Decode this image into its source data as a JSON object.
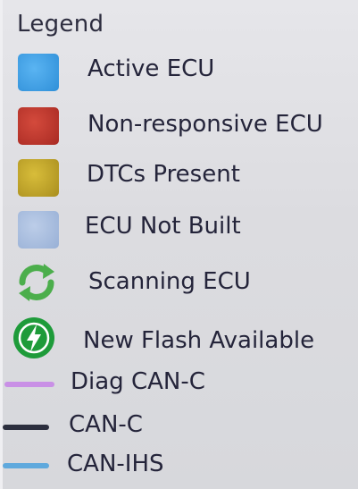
{
  "legend": {
    "title": "Legend",
    "items": [
      {
        "label": "Active ECU",
        "icon": "blue-square-icon",
        "color": "#3e9fe6"
      },
      {
        "label": "Non-responsive ECU",
        "icon": "red-square-icon",
        "color": "#c0332b"
      },
      {
        "label": "DTCs Present",
        "icon": "yellow-square-icon",
        "color": "#c9ad2a"
      },
      {
        "label": "ECU Not Built",
        "icon": "light-blue-square-icon",
        "color": "#a9bfdf"
      },
      {
        "label": "Scanning ECU",
        "icon": "refresh-arrows-icon",
        "color": "#4cae4c"
      },
      {
        "label": "New Flash Available",
        "icon": "lightning-circle-icon",
        "color": "#1e9b3a"
      },
      {
        "label": "Diag CAN-C",
        "icon": "violet-line-icon",
        "color": "#c990e6"
      },
      {
        "label": "CAN-C",
        "icon": "dark-line-icon",
        "color": "#2c2f3e"
      },
      {
        "label": "CAN-IHS",
        "icon": "sky-line-icon",
        "color": "#5fa9dd"
      }
    ]
  }
}
